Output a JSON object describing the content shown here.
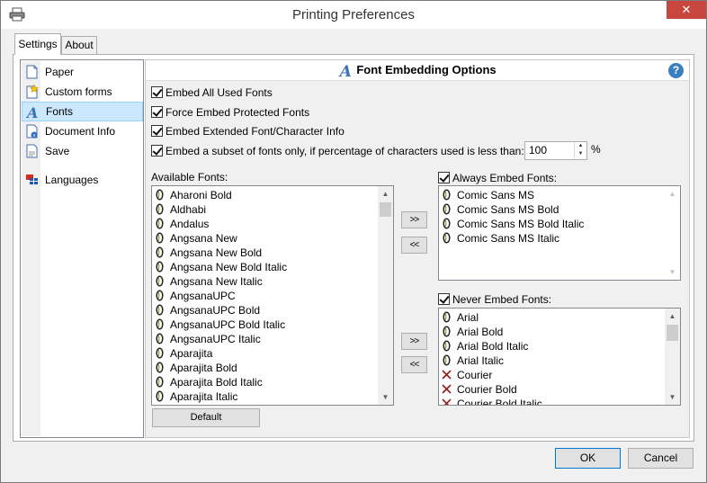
{
  "window": {
    "title": "Printing Preferences",
    "close_label": "✕"
  },
  "tabs": [
    {
      "label": "Settings",
      "active": true
    },
    {
      "label": "About",
      "active": false
    }
  ],
  "sidebar": {
    "items": [
      {
        "label": "Paper",
        "icon": "paper-icon"
      },
      {
        "label": "Custom forms",
        "icon": "custom-forms-icon"
      },
      {
        "label": "Fonts",
        "icon": "fonts-icon",
        "selected": true
      },
      {
        "label": "Document Info",
        "icon": "document-info-icon"
      },
      {
        "label": "Save",
        "icon": "save-icon"
      },
      {
        "label": "Languages",
        "icon": "languages-icon"
      }
    ]
  },
  "panel": {
    "title": "Font Embedding Options",
    "help_label": "?",
    "options": [
      {
        "label": "Embed All Used Fonts",
        "checked": true
      },
      {
        "label": "Force Embed Protected Fonts",
        "checked": true
      },
      {
        "label": "Embed Extended Font/Character Info",
        "checked": true
      },
      {
        "label": "Embed a subset of fonts only, if percentage of characters used is less than:",
        "checked": true
      }
    ],
    "subset_percentage": "100",
    "percent_sign": "%",
    "available_fonts_label": "Available Fonts:",
    "available_fonts": [
      "Aharoni Bold",
      "Aldhabi",
      "Andalus",
      "Angsana New",
      "Angsana New Bold",
      "Angsana New Bold Italic",
      "Angsana New Italic",
      "AngsanaUPC",
      "AngsanaUPC Bold",
      "AngsanaUPC Bold Italic",
      "AngsanaUPC Italic",
      "Aparajita",
      "Aparajita Bold",
      "Aparajita Bold Italic",
      "Aparajita Italic"
    ],
    "always_embed_label": "Always Embed Fonts:",
    "always_embed_checked": true,
    "always_embed_fonts": [
      "Comic Sans MS",
      "Comic Sans MS Bold",
      "Comic Sans MS Bold Italic",
      "Comic Sans MS Italic"
    ],
    "never_embed_label": "Never Embed Fonts:",
    "never_embed_checked": true,
    "never_embed_fonts": [
      {
        "name": "Arial",
        "icon": "opentype-font-icon"
      },
      {
        "name": "Arial Bold",
        "icon": "opentype-font-icon"
      },
      {
        "name": "Arial Bold Italic",
        "icon": "opentype-font-icon"
      },
      {
        "name": "Arial Italic",
        "icon": "opentype-font-icon"
      },
      {
        "name": "Courier",
        "icon": "raster-font-icon"
      },
      {
        "name": "Courier Bold",
        "icon": "raster-font-icon"
      },
      {
        "name": "Courier Bold Italic",
        "icon": "raster-font-icon"
      }
    ],
    "add_label": ">>",
    "remove_label": "<<",
    "default_label": "Default"
  },
  "footer": {
    "ok_label": "OK",
    "cancel_label": "Cancel"
  },
  "colors": {
    "selection": "#cce8ff",
    "close_button": "#c7463d",
    "accent": "#0078d7"
  }
}
